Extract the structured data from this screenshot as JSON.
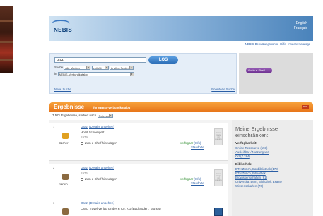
{
  "header": {
    "logo": "NEBIS",
    "lang_en": "English",
    "lang_fr": "Français",
    "toplinks": [
      "NEBIS-Benutzungskonto",
      "Hilfe",
      "Andere Kataloge"
    ]
  },
  "search": {
    "query": "graz",
    "go_label": "LOS",
    "row1_label": "Suche",
    "media": "alle Medien",
    "operator": "enthält",
    "field": "in allen Feldern",
    "catalog_label": "in",
    "catalog": "NEBIS-Verbundkatalog",
    "neue_suche": "Neue Suche",
    "erweiterte": "Erweiterte Suche"
  },
  "eshelf": {
    "label": "Go to e-Shelf"
  },
  "results": {
    "title": "Ergebnisse",
    "subtitle": "für NEBIS-Verbundkatalog",
    "rss": "RSS",
    "count": "7.571 Ergebnisse, sortiert nach",
    "sort": "Relevanz"
  },
  "items": [
    {
      "num": "1",
      "title": "Graz",
      "details": "(Details ansehen)",
      "author": "Horst Schweigert",
      "year": "1979",
      "type": "Bücher",
      "add": "Zum e-Shelf hinzufügen",
      "avail": "verfügbar",
      "avail_link": "(Info)",
      "standorte": "Standorte",
      "cover": "Cover image not available",
      "icon": "book-icon"
    },
    {
      "num": "2",
      "title": "Graz",
      "details": "(Details ansehen)",
      "author": "",
      "year": "1976",
      "type": "Karten",
      "add": "Zum e-Shelf hinzufügen",
      "avail": "verfügbar",
      "avail_link": "(Info)",
      "standorte": "Standorte",
      "cover": "Cover image not available",
      "icon": "map-icon"
    },
    {
      "num": "3",
      "title": "Graz",
      "details": "(Details ansehen)",
      "author": "Carto Travel Verlag GmbH & Co. KG (Bad Soden, Taunus)",
      "year": "",
      "type": "",
      "add": "",
      "avail": "",
      "avail_link": "",
      "standorte": "",
      "cover": "",
      "icon": "map-icon"
    }
  ],
  "facets": {
    "title": "Meine Ergebnisse einschränken:",
    "h1": "Verfügbarkeit:",
    "avail_items": [
      "Online Ressource (193)",
      "Ausleihbar / Nutzung vor",
      "Ort (7.284)"
    ],
    "h2": "Bibliothek:",
    "lib_items": [
      "ETH Zürich, Baubibliothek (178)",
      "ETH Zürich, Bibliothek",
      "Erdwissenschaften (61)",
      "Universität Bern, Bibliothek Exakte",
      "Wissenschaften (76)"
    ]
  }
}
